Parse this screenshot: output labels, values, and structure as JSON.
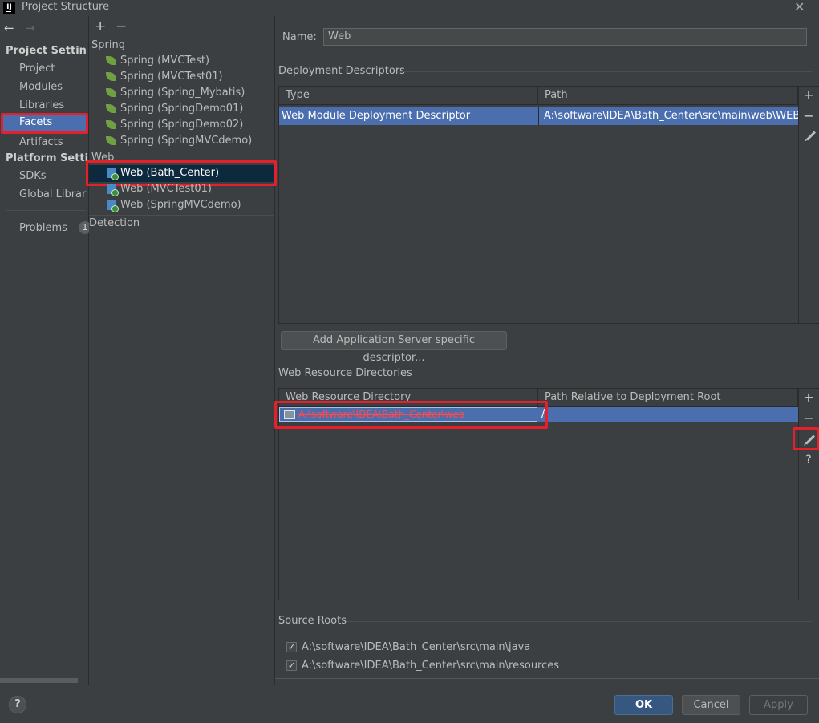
{
  "window": {
    "title": "Project Structure",
    "app_icon": "IJ",
    "close": "✕"
  },
  "nav": {
    "back": "←",
    "forward": "→",
    "project_settings": "Project Settings",
    "project_items": [
      "Project",
      "Modules",
      "Libraries",
      "Facets",
      "Artifacts"
    ],
    "platform_settings": "Platform Settings",
    "platform_items": [
      "SDKs",
      "Global Libraries"
    ],
    "problems": "Problems",
    "problems_count": "1"
  },
  "tree": {
    "add": "+",
    "remove": "−",
    "spring_group": "Spring",
    "spring_items": [
      "Spring (MVCTest)",
      "Spring (MVCTest01)",
      "Spring (Spring_Mybatis)",
      "Spring (SpringDemo01)",
      "Spring (SpringDemo02)",
      "Spring (SpringMVCdemo)"
    ],
    "web_group": "Web",
    "web_items": [
      "Web (Bath_Center)",
      "Web (MVCTest01)",
      "Web (SpringMVCdemo)"
    ],
    "detection": "Detection"
  },
  "facet": {
    "name_label": "Name:",
    "name_value": "Web",
    "deployment_descriptors": {
      "title": "Deployment Descriptors",
      "columns": [
        "Type",
        "Path"
      ],
      "rows": [
        {
          "type": "Web Module Deployment Descriptor",
          "path": "A:\\software\\IDEA\\Bath_Center\\src\\main\\web\\WEB-INF\\web.xml"
        }
      ],
      "add_server_button": "Add Application Server specific descriptor..."
    },
    "web_resource": {
      "title": "Web Resource Directories",
      "columns": [
        "Web Resource Directory",
        "Path Relative to Deployment Root"
      ],
      "rows": [
        {
          "directory": "A:\\software\\IDEA\\Bath_Center\\web",
          "path": "/"
        }
      ],
      "help": "?"
    },
    "source_roots": {
      "title": "Source Roots",
      "items": [
        "A:\\software\\IDEA\\Bath_Center\\src\\main\\java",
        "A:\\software\\IDEA\\Bath_Center\\src\\main\\resources"
      ],
      "checked": [
        true,
        true
      ]
    }
  },
  "footer": {
    "help": "?",
    "ok": "OK",
    "cancel": "Cancel",
    "apply": "Apply"
  },
  "colors": {
    "selection": "#4b6eaf",
    "highlight": "#e5202a",
    "background": "#3c3f41"
  }
}
